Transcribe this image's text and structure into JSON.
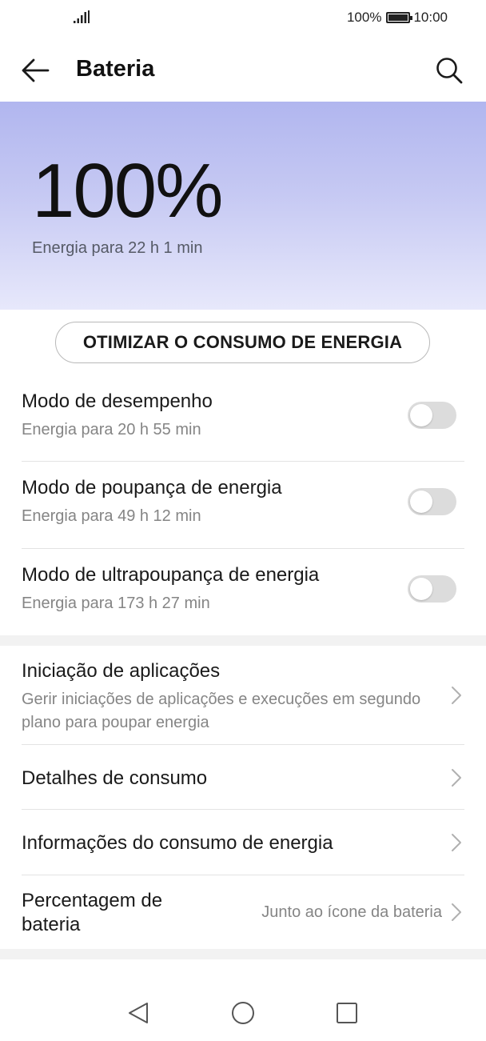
{
  "status_bar": {
    "battery_percent": "100%",
    "time": "10:00"
  },
  "header": {
    "title": "Bateria"
  },
  "hero": {
    "percent": "100%",
    "remaining": "Energia para 22 h 1 min"
  },
  "optimize_button": "OTIMIZAR O CONSUMO DE ENERGIA",
  "modes": [
    {
      "title": "Modo de desempenho",
      "subtitle": "Energia para 20 h 55 min",
      "enabled": false
    },
    {
      "title": "Modo de poupança de energia",
      "subtitle": "Energia para 49 h 12 min",
      "enabled": false
    },
    {
      "title": "Modo de ultrapoupança de energia",
      "subtitle": "Energia para 173 h 27 min",
      "enabled": false
    }
  ],
  "settings": [
    {
      "title": "Iniciação de aplicações",
      "subtitle": "Gerir iniciações de aplicações e execuções em segundo plano para poupar energia"
    },
    {
      "title": "Detalhes de consumo"
    },
    {
      "title": "Informações do consumo de energia"
    },
    {
      "title": "Percentagem de bateria",
      "value": "Junto ao ícone da bateria"
    }
  ],
  "icons": {
    "back": "arrow-left-icon",
    "search": "search-icon",
    "chevron": "chevron-right-icon",
    "nav_back": "triangle-back-icon",
    "nav_home": "circle-home-icon",
    "nav_recent": "square-recent-icon"
  },
  "colors": {
    "hero_gradient_top": "#b1b6ef",
    "hero_gradient_bottom": "#e7e8fb",
    "toggle_off": "#dcdcdc"
  }
}
